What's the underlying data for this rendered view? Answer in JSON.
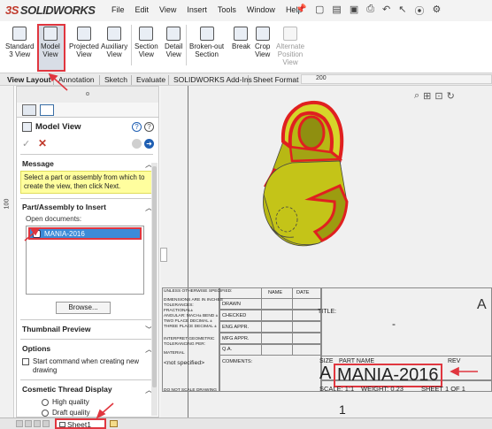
{
  "app": {
    "logo_text_ds": "3S",
    "logo_text": "SOLIDWORKS",
    "menu": [
      "File",
      "Edit",
      "View",
      "Insert",
      "Tools",
      "Window",
      "Help"
    ]
  },
  "ribbon": {
    "commands": [
      {
        "label": "Standard\n3 View"
      },
      {
        "label": "Model\nView"
      },
      {
        "label": "Projected\nView"
      },
      {
        "label": "Auxiliary\nView"
      },
      {
        "label": "Section\nView"
      },
      {
        "label": "Detail\nView"
      },
      {
        "label": "Broken-out\nSection"
      },
      {
        "label": "Break"
      },
      {
        "label": "Crop\nView"
      },
      {
        "label": "Alternate\nPosition\nView"
      }
    ]
  },
  "tabs": [
    "View Layout",
    "Annotation",
    "Sketch",
    "Evaluate",
    "SOLIDWORKS Add-Ins",
    "Sheet Format"
  ],
  "rulers": {
    "top_value": "200",
    "left_value": "100"
  },
  "panel": {
    "title": "Model View",
    "help_glyph": "?",
    "message_header": "Message",
    "message_text": "Select a part or assembly from which to create the view, then click Next.",
    "part_header": "Part/Assembly to Insert",
    "open_docs_label": "Open documents:",
    "documents": [
      "MANIA-2016"
    ],
    "browse_label": "Browse...",
    "thumbnail_header": "Thumbnail Preview",
    "options_header": "Options",
    "start_command_label": "Start command when creating new drawing",
    "cosmetic_header": "Cosmetic Thread Display",
    "radio_high": "High quality",
    "radio_draft": "Draft quality"
  },
  "title_block": {
    "unless_otherwise": "UNLESS OTHERWISE SPECIFIED:",
    "dims": "DIMENSIONS ARE IN INCHES",
    "tolerances": "TOLERANCES:",
    "fractional": "FRACTIONAL±",
    "angular": "ANGULAR: MACH±   BEND ±",
    "two_place": "TWO PLACE DECIMAL  ±",
    "three_place": "THREE PLACE DECIMAL  ±",
    "interpret": "INTERPRET GEOMETRIC",
    "tolerancing": "TOLERANCING PER:",
    "material": "MATERIAL",
    "not_specified": "<not specified>",
    "do_not_scale": "DO NOT SCALE DRAWING",
    "name": "NAME",
    "date": "DATE",
    "drawn": "DRAWN",
    "checked": "CHECKED",
    "eng_appr": "ENG APPR.",
    "mfg_appr": "MFG APPR.",
    "qa": "Q.A.",
    "comments": "COMMENTS:",
    "title_label": "TITLE:",
    "size_label": "SIZE",
    "part_name_label": "PART NAME",
    "rev_label": "REV",
    "size_value": "A",
    "part_name": "MANIA-2016",
    "scale": "SCALE: 1:1",
    "weight": "WEIGHT: 0.23",
    "sheet_of": "SHEET 1 OF 1",
    "dash": "-",
    "zone_letter": "A",
    "zone_number": "1"
  },
  "sheets": {
    "active": "Sheet1"
  },
  "colors": {
    "accent_red": "#e0363f",
    "selection_blue": "#3b8bd8",
    "model_yellow": "#c8c81a",
    "model_red": "#e02020",
    "message_yellow": "#fffe9e"
  }
}
